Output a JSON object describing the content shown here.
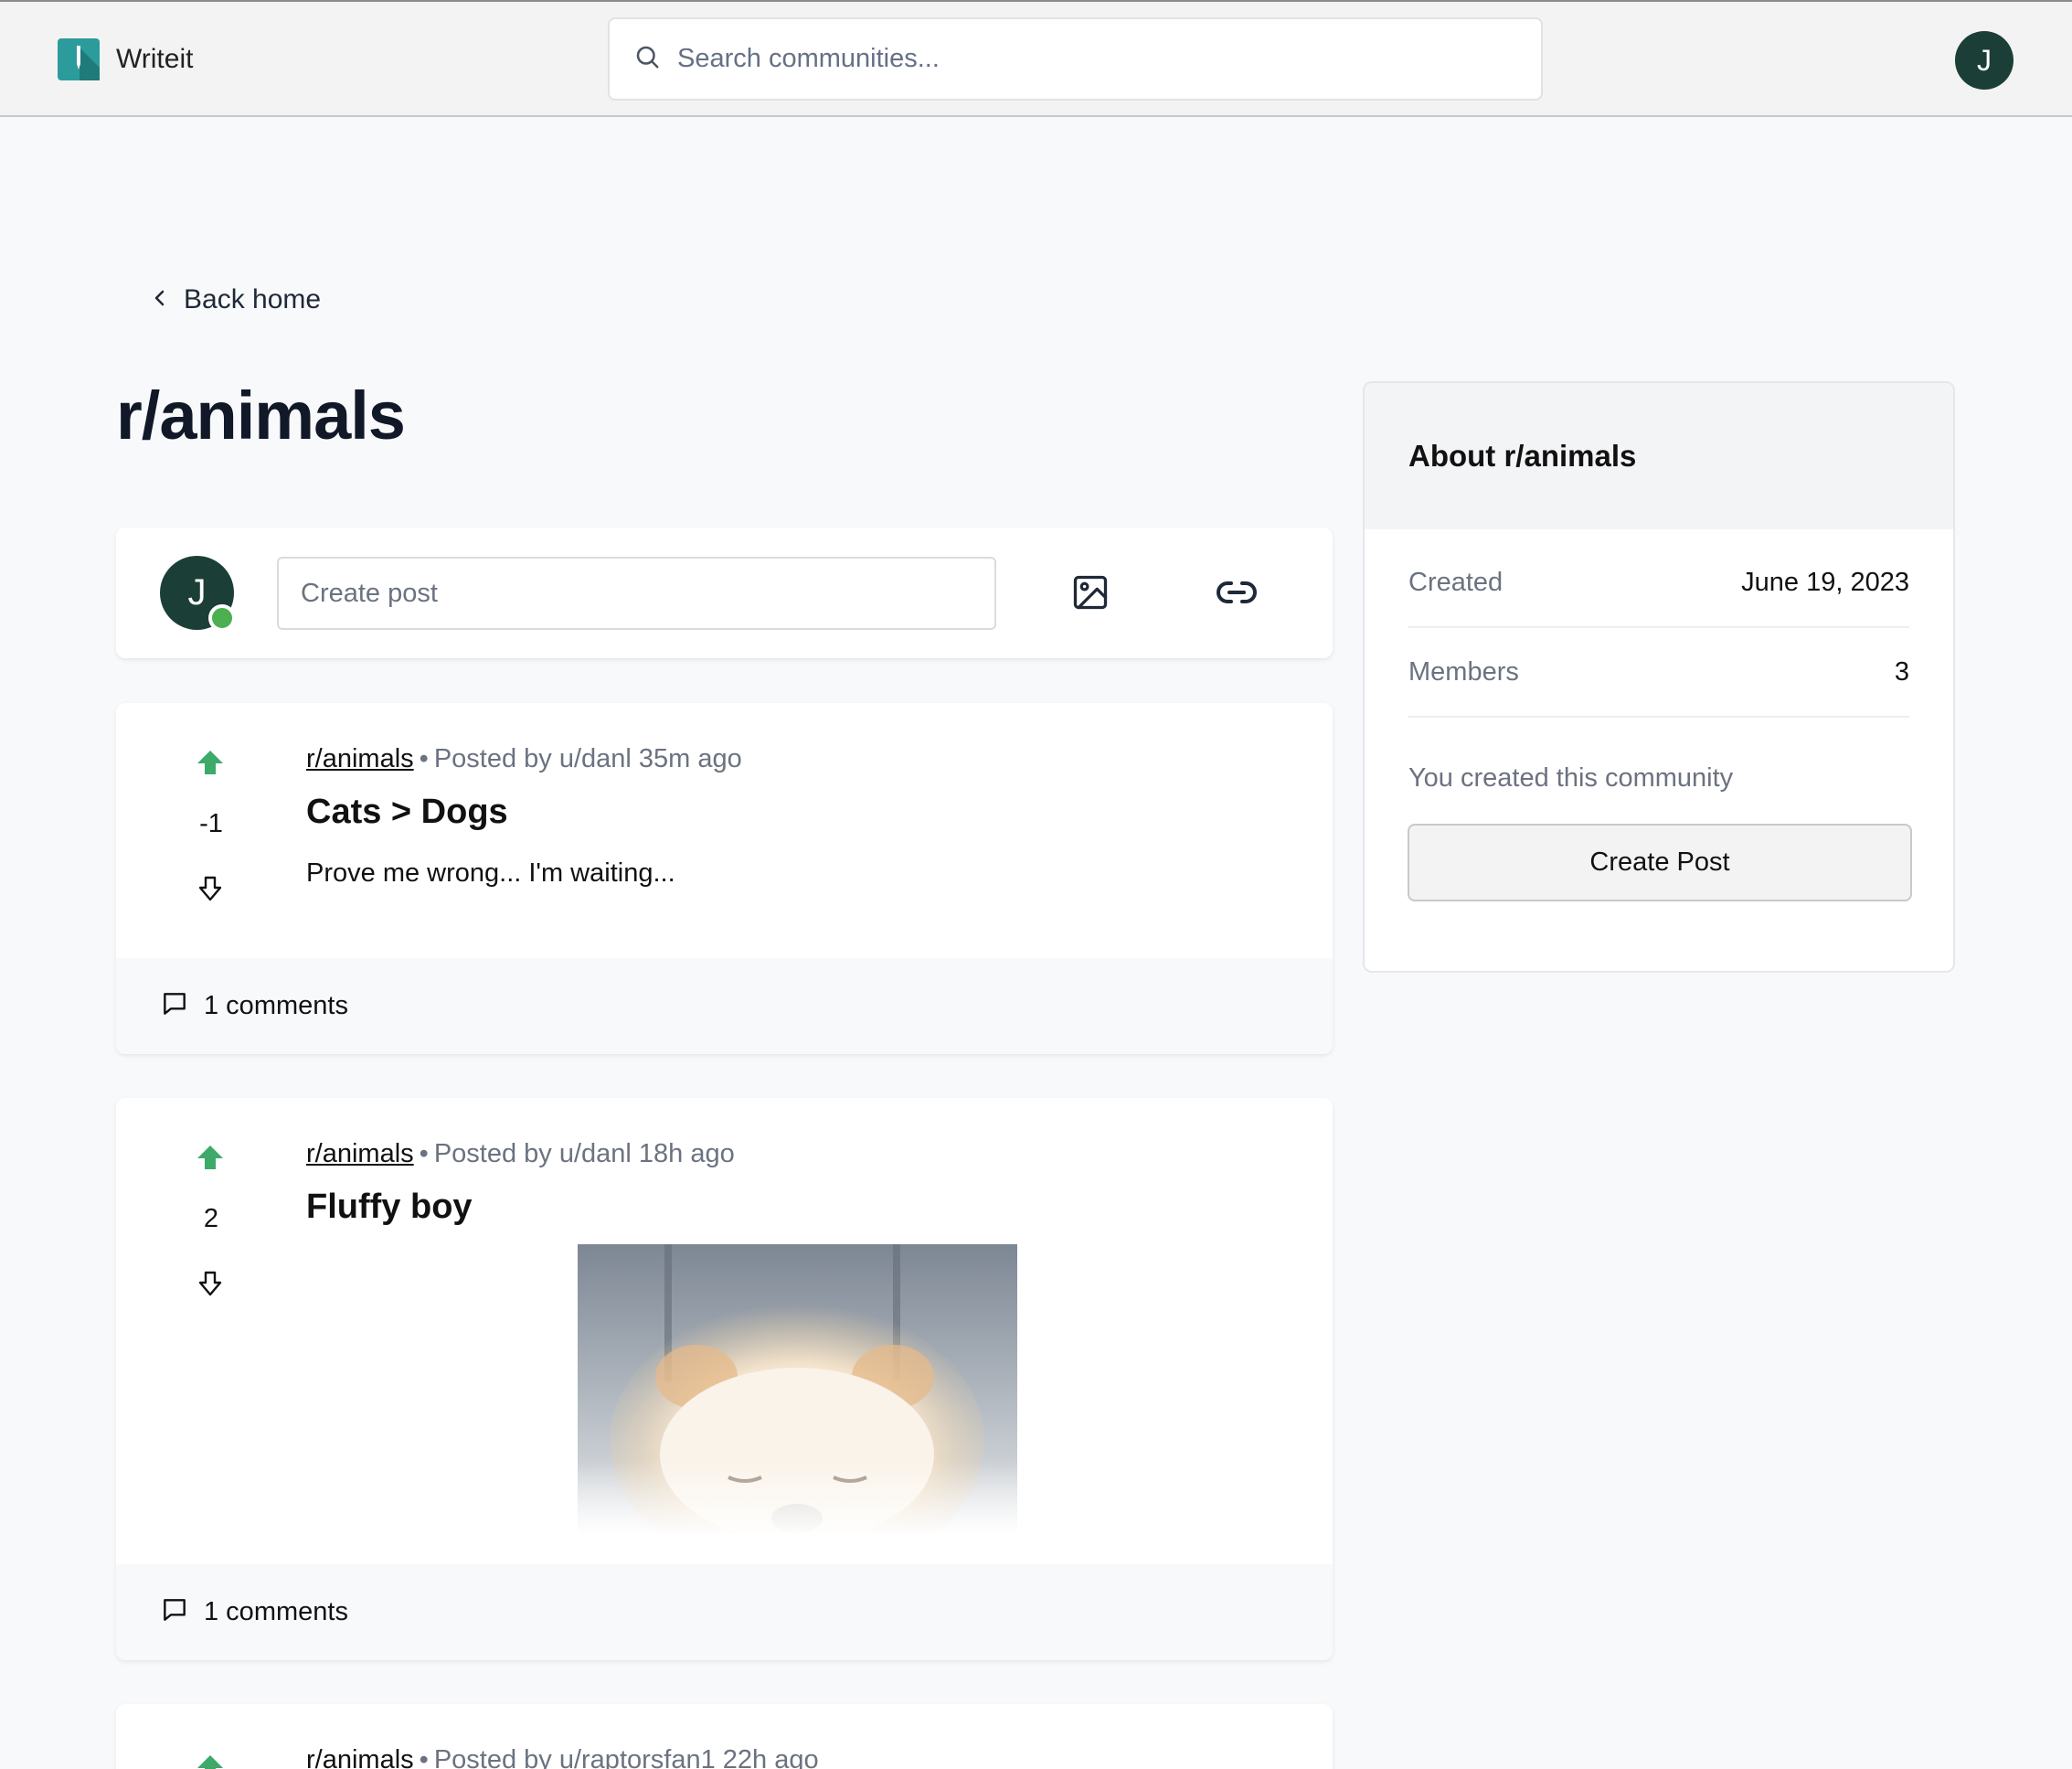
{
  "header": {
    "app_name": "Writeit",
    "search_placeholder": "Search communities...",
    "user_initial": "J",
    "brand_color": "#2c9b9b"
  },
  "nav": {
    "back_label": "Back home"
  },
  "community": {
    "title": "r/animals"
  },
  "create_post": {
    "user_initial": "J",
    "placeholder": "Create post",
    "image_icon": "image-icon",
    "link_icon": "link-icon"
  },
  "posts": [
    {
      "subreddit": "r/animals",
      "meta": "Posted by u/danl 35m ago",
      "title": "Cats > Dogs",
      "text": "Prove me wrong... I'm waiting...",
      "score": "-1",
      "comments": "1 comments"
    },
    {
      "subreddit": "r/animals",
      "meta": "Posted by u/danl 18h ago",
      "title": "Fluffy boy",
      "score": "2",
      "comments": "1 comments",
      "image": "fluffy dog photo"
    },
    {
      "subreddit": "r/animals",
      "meta": "Posted by u/raptorsfan1 22h ago"
    }
  ],
  "sidebar": {
    "title": "About r/animals",
    "created_label": "Created",
    "created_value": "June 19, 2023",
    "members_label": "Members",
    "members_value": "3",
    "owner_note": "You created this community",
    "button_label": "Create Post"
  },
  "colors": {
    "upvote": "#3daa6a",
    "avatar": "#1b3f36",
    "online": "#4caf50"
  }
}
